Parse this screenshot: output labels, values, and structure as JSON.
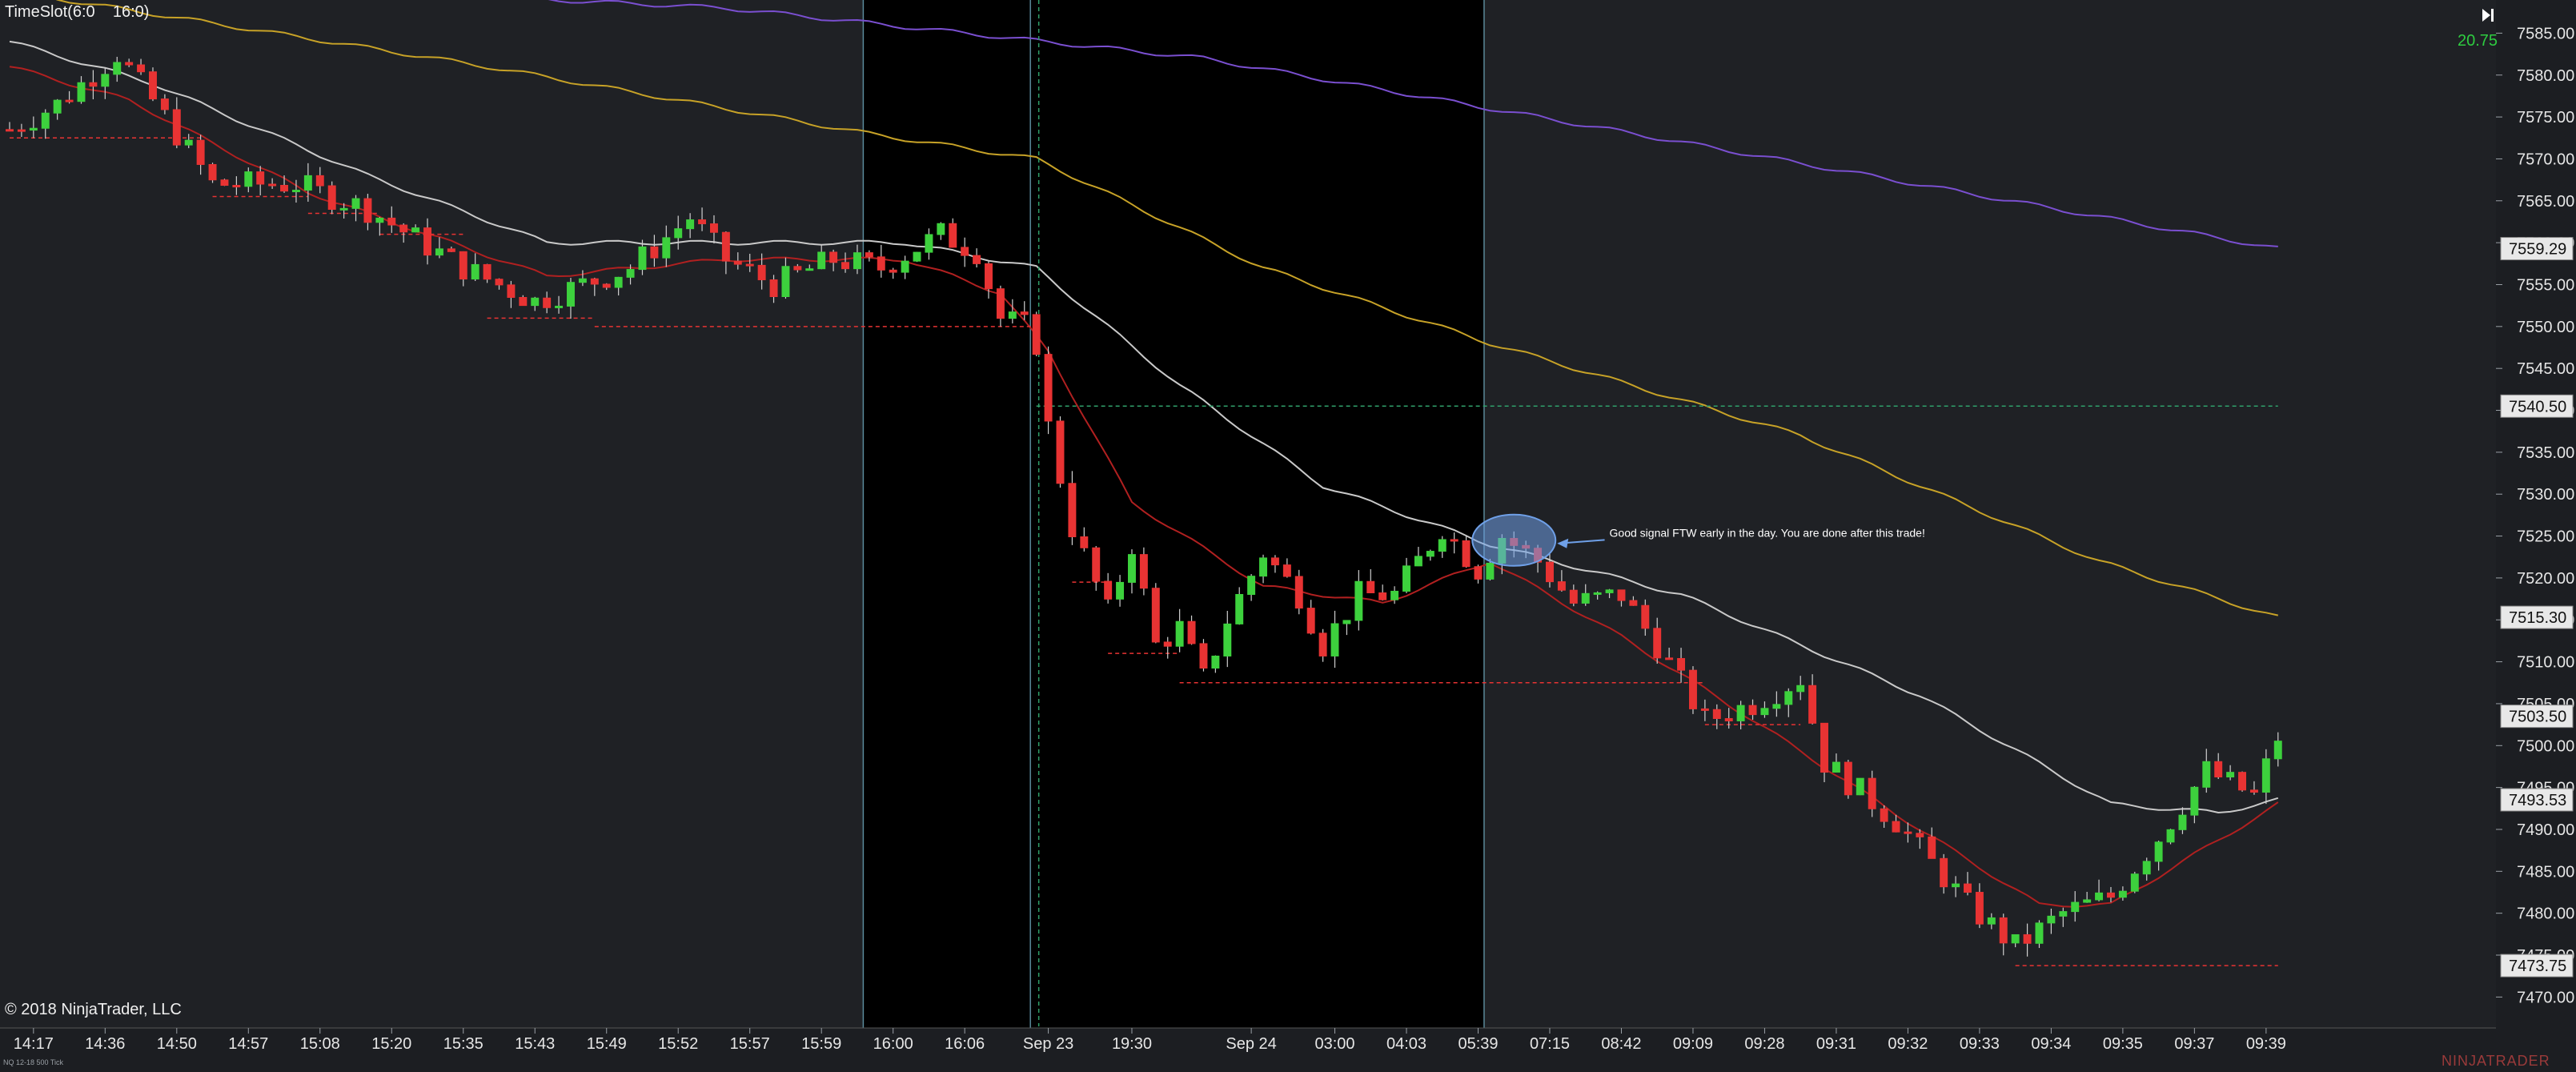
{
  "indicator_label": "TimeSlot(6:0    16:0)",
  "copyright": "© 2018 NinjaTrader, LLC",
  "instrument": "NQ 12-18 500 Tick",
  "brand": "NINJATRADER",
  "top_value": "20.75",
  "colors": {
    "background": "#1f2125",
    "session_shade": "#000000",
    "grid": "#2a2c30",
    "bull": "#3dd13d",
    "bear": "#e83333",
    "ema_fast": "#b02020",
    "ema_mid": "#c9c9c9",
    "ema_slow": "#c7a227",
    "ema_long": "#7a4fd0",
    "pivot_line": "#e83333",
    "level_line": "#2fa06a",
    "annotation": "#6fa0e8"
  },
  "icons": {
    "play": "skip-forward-icon"
  },
  "annotation": {
    "text": "Good signal FTW early in the day. You are done after this trade!"
  },
  "chart_data": {
    "type": "candlestick",
    "title": "",
    "xlabel": "",
    "ylabel": "",
    "ylim": [
      7466.5,
      7588
    ],
    "grid": false,
    "n_bars": 200,
    "price_axis": {
      "ticks": [
        "7585.00",
        "7580.00",
        "7575.00",
        "7570.00",
        "7565.00",
        "7560.00",
        "7555.00",
        "7550.00",
        "7545.00",
        "7540.00",
        "7535.00",
        "7530.00",
        "7525.00",
        "7520.00",
        "7515.00",
        "7510.00",
        "7505.00",
        "7500.00",
        "7495.00",
        "7490.00",
        "7485.00",
        "7480.00",
        "7475.00",
        "7470.00"
      ],
      "markers": [
        {
          "label": "7559.29",
          "value": 7559.29
        },
        {
          "label": "7540.50",
          "value": 7540.5
        },
        {
          "label": "7515.30",
          "value": 7515.3
        },
        {
          "label": "7503.50",
          "value": 7503.5
        },
        {
          "label": "7493.53",
          "value": 7493.53
        },
        {
          "label": "7473.75",
          "value": 7473.75
        }
      ]
    },
    "time_axis": {
      "labels": [
        {
          "label": "14:17",
          "bar": 2
        },
        {
          "label": "14:36",
          "bar": 8
        },
        {
          "label": "14:50",
          "bar": 14
        },
        {
          "label": "14:57",
          "bar": 20
        },
        {
          "label": "15:08",
          "bar": 26
        },
        {
          "label": "15:20",
          "bar": 32
        },
        {
          "label": "15:35",
          "bar": 38
        },
        {
          "label": "15:43",
          "bar": 44
        },
        {
          "label": "15:49",
          "bar": 50
        },
        {
          "label": "15:52",
          "bar": 56
        },
        {
          "label": "15:57",
          "bar": 62
        },
        {
          "label": "15:59",
          "bar": 68
        },
        {
          "label": "16:00",
          "bar": 74
        },
        {
          "label": "16:06",
          "bar": 80
        },
        {
          "label": "Sep 23",
          "bar": 87
        },
        {
          "label": "19:30",
          "bar": 94
        },
        {
          "label": "Sep 24",
          "bar": 104
        },
        {
          "label": "03:00",
          "bar": 111
        },
        {
          "label": "04:03",
          "bar": 117
        },
        {
          "label": "05:39",
          "bar": 123
        },
        {
          "label": "07:15",
          "bar": 129
        },
        {
          "label": "08:42",
          "bar": 135
        },
        {
          "label": "09:09",
          "bar": 141
        },
        {
          "label": "09:28",
          "bar": 147
        },
        {
          "label": "09:31",
          "bar": 153
        },
        {
          "label": "09:32",
          "bar": 159
        },
        {
          "label": "09:33",
          "bar": 165
        },
        {
          "label": "09:34",
          "bar": 171
        },
        {
          "label": "09:35",
          "bar": 177
        },
        {
          "label": "09:37",
          "bar": 183
        },
        {
          "label": "09:39",
          "bar": 189
        }
      ]
    },
    "session_shading": [
      {
        "from_bar": 72,
        "to_bar": 124
      }
    ],
    "session_lines": [
      {
        "bar": 72
      },
      {
        "bar": 86
      },
      {
        "bar": 124
      }
    ],
    "price_anchors": [
      [
        0,
        7573.5
      ],
      [
        4,
        7576.5
      ],
      [
        9,
        7582.5
      ],
      [
        12,
        7577
      ],
      [
        17,
        7567
      ],
      [
        24,
        7567
      ],
      [
        30,
        7564
      ],
      [
        38,
        7557
      ],
      [
        44,
        7553
      ],
      [
        52,
        7557
      ],
      [
        57,
        7563
      ],
      [
        60,
        7558
      ],
      [
        64,
        7555
      ],
      [
        69,
        7558
      ],
      [
        73,
        7557
      ],
      [
        78,
        7561
      ],
      [
        81,
        7559
      ],
      [
        83,
        7551
      ],
      [
        85,
        7550
      ],
      [
        86,
        7548
      ],
      [
        87,
        7538
      ],
      [
        89,
        7526
      ],
      [
        92,
        7516
      ],
      [
        94,
        7524
      ],
      [
        96,
        7512
      ],
      [
        98,
        7514
      ],
      [
        100,
        7508
      ],
      [
        102,
        7515
      ],
      [
        105,
        7523
      ],
      [
        108,
        7518
      ],
      [
        110,
        7512
      ],
      [
        113,
        7518
      ],
      [
        116,
        7518
      ],
      [
        120,
        7526
      ],
      [
        123,
        7521
      ],
      [
        125,
        7525
      ],
      [
        128,
        7522
      ],
      [
        131,
        7517
      ],
      [
        135,
        7518
      ],
      [
        138,
        7512
      ],
      [
        142,
        7503
      ],
      [
        146,
        7505
      ],
      [
        150,
        7508
      ],
      [
        152,
        7498
      ],
      [
        158,
        7491
      ],
      [
        164,
        7481
      ],
      [
        168,
        7476
      ],
      [
        172,
        7480
      ],
      [
        176,
        7482
      ],
      [
        180,
        7489
      ],
      [
        184,
        7497
      ],
      [
        188,
        7494
      ],
      [
        190,
        7501
      ]
    ],
    "series": [
      {
        "name": "",
        "style": "ema_long",
        "points": [
          [
            0,
            7592
          ],
          [
            60,
            7588
          ],
          [
            100,
            7582
          ],
          [
            140,
            7572
          ],
          [
            190,
            7559.3
          ]
        ]
      },
      {
        "name": "",
        "style": "ema_slow",
        "points": [
          [
            0,
            7590
          ],
          [
            40,
            7581
          ],
          [
            72,
            7573
          ],
          [
            86,
            7570
          ],
          [
            105,
            7557
          ],
          [
            124,
            7548
          ],
          [
            150,
            7537
          ],
          [
            175,
            7522
          ],
          [
            190,
            7515.3
          ]
        ]
      },
      {
        "name": "",
        "style": "ema_mid",
        "points": [
          [
            0,
            7584
          ],
          [
            12,
            7579
          ],
          [
            30,
            7568
          ],
          [
            45,
            7560
          ],
          [
            60,
            7560
          ],
          [
            75,
            7560
          ],
          [
            86,
            7557
          ],
          [
            98,
            7543
          ],
          [
            110,
            7531
          ],
          [
            124,
            7524
          ],
          [
            140,
            7518
          ],
          [
            160,
            7506
          ],
          [
            176,
            7493
          ],
          [
            185,
            7492
          ],
          [
            190,
            7493.5
          ]
        ]
      },
      {
        "name": "",
        "style": "ema_fast",
        "points": [
          [
            0,
            7581
          ],
          [
            10,
            7577
          ],
          [
            25,
            7566
          ],
          [
            45,
            7556
          ],
          [
            60,
            7558
          ],
          [
            75,
            7558
          ],
          [
            83,
            7554
          ],
          [
            87,
            7547
          ],
          [
            94,
            7529
          ],
          [
            105,
            7519
          ],
          [
            115,
            7517
          ],
          [
            124,
            7522
          ],
          [
            135,
            7513
          ],
          [
            145,
            7504
          ],
          [
            160,
            7490
          ],
          [
            170,
            7481
          ],
          [
            176,
            7481
          ],
          [
            183,
            7487
          ],
          [
            190,
            7493
          ]
        ]
      }
    ],
    "pivot_lines": [
      {
        "from_bar": 0,
        "to_bar": 16,
        "value": 7572.5
      },
      {
        "from_bar": 17,
        "to_bar": 25,
        "value": 7565.5
      },
      {
        "from_bar": 25,
        "to_bar": 31,
        "value": 7563.5
      },
      {
        "from_bar": 31,
        "to_bar": 38,
        "value": 7561
      },
      {
        "from_bar": 40,
        "to_bar": 49,
        "value": 7551
      },
      {
        "from_bar": 49,
        "to_bar": 86,
        "value": 7550
      },
      {
        "from_bar": 89,
        "to_bar": 92,
        "value": 7519.5
      },
      {
        "from_bar": 92,
        "to_bar": 98,
        "value": 7511
      },
      {
        "from_bar": 98,
        "to_bar": 142,
        "value": 7507.5
      },
      {
        "from_bar": 142,
        "to_bar": 150,
        "value": 7502.5
      },
      {
        "from_bar": 168,
        "to_bar": 190,
        "value": 7473.75
      }
    ],
    "level_lines": [
      {
        "from_bar": 86,
        "to_bar": 190,
        "value": 7540.5
      },
      {
        "bar": 86,
        "vertical": true
      }
    ],
    "annotation": {
      "center_bar": 126,
      "value": 7524.5,
      "text_bar": 134,
      "text_value": 7525.5
    }
  }
}
